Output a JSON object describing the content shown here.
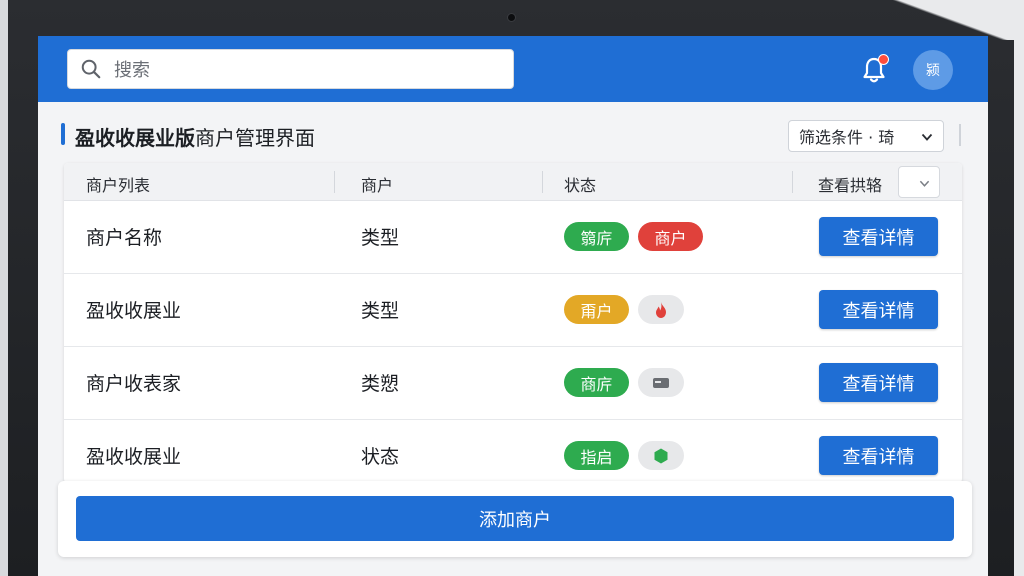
{
  "theme": {
    "primary": "#1f6ed4",
    "green": "#2eab4f",
    "red": "#e0413b",
    "amber": "#e3a826",
    "notify_dot": "#ff4d3d"
  },
  "header": {
    "search": {
      "placeholder": "搜索",
      "icon": "search-icon"
    },
    "notification_icon": "bell-icon",
    "avatar_text": "颍"
  },
  "page": {
    "title_bold": "盈收收展业版",
    "title_rest": "商户管理界面",
    "filter": {
      "label": "筛选条件 · 琦",
      "icon": "chevron-down-icon"
    }
  },
  "table": {
    "headers": [
      "商户列表",
      "商户",
      "状态",
      "查看拱辂"
    ],
    "rows": [
      {
        "name": "商户名称",
        "type": "类型",
        "badges": [
          {
            "text": "篛庍",
            "color": "#2eab4f"
          },
          {
            "text": "商户",
            "color": "#e0413b"
          }
        ],
        "action": "查看详情"
      },
      {
        "name": "盈收收展业",
        "type": "类型",
        "badges": [
          {
            "text": "甭户",
            "color": "#e3a826"
          },
          {
            "icon": "flame-icon",
            "icon_color": "#e0413b"
          }
        ],
        "action": "查看详情"
      },
      {
        "name": "商户收表家",
        "type": "类愬",
        "badges": [
          {
            "text": "商庍",
            "color": "#2eab4f"
          },
          {
            "icon": "card-icon",
            "icon_color": "#6a6d72"
          }
        ],
        "action": "查看详情"
      },
      {
        "name": "盈收收展业",
        "type": "状态",
        "badges": [
          {
            "text": "指启",
            "color": "#2eab4f"
          },
          {
            "icon": "leaf-icon",
            "icon_color": "#2eab4f"
          }
        ],
        "action": "查看详情"
      }
    ]
  },
  "footer": {
    "add_label": "添加商户"
  }
}
